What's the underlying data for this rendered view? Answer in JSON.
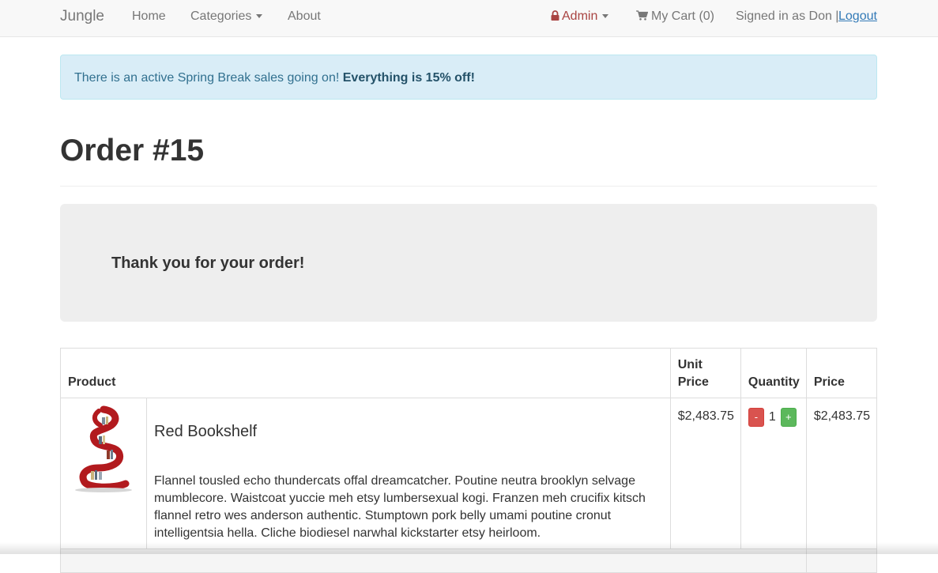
{
  "navbar": {
    "brand": "Jungle",
    "home": "Home",
    "categories": "Categories",
    "about": "About",
    "admin": "Admin",
    "cart": "My Cart (0)",
    "signed_in": "Signed in as Don |",
    "logout": "Logout"
  },
  "alert": {
    "text": "There is an active Spring Break sales going on! ",
    "emphasis": "Everything is 15% off!"
  },
  "page": {
    "title": "Order #15",
    "thanks": "Thank you for your order!"
  },
  "table": {
    "headers": {
      "product": "Product",
      "unit_price": "Unit Price",
      "quantity": "Quantity",
      "price": "Price"
    },
    "rows": [
      {
        "name": "Red Bookshelf",
        "description": "Flannel tousled echo thundercats offal dreamcatcher. Poutine neutra brooklyn selvage mumblecore. Waistcoat yuccie meh etsy lumbersexual kogi. Franzen meh crucifix kitsch flannel retro wes anderson authentic. Stumptown pork belly umami poutine cronut intelligentsia hella. Cliche biodiesel narwhal kickstarter etsy heirloom.",
        "unit_price": "$2,483.75",
        "quantity": "1",
        "minus": "-",
        "plus": "+",
        "price": "$2,483.75"
      }
    ]
  },
  "colors": {
    "admin": "#a94442",
    "link": "#337ab7",
    "alert_bg": "#d9edf7",
    "minus_button": "#d9534f",
    "plus_button": "#5cb85c",
    "product_red": "#b21a1e"
  },
  "icons": {
    "lock": "lock-icon",
    "cart": "cart-icon",
    "caret": "caret-down-icon"
  }
}
